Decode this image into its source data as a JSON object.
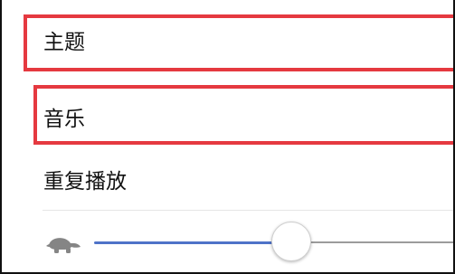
{
  "settings": {
    "items": [
      {
        "label": "主题"
      },
      {
        "label": "音乐"
      },
      {
        "label": "重复播放"
      }
    ]
  },
  "speed_slider": {
    "icon": "turtle-icon",
    "value_fraction": 0.48
  },
  "colors": {
    "highlight": "#e53940",
    "slider_active": "#4f73c8",
    "slider_inactive": "#9b9b9b",
    "text": "#111111"
  }
}
